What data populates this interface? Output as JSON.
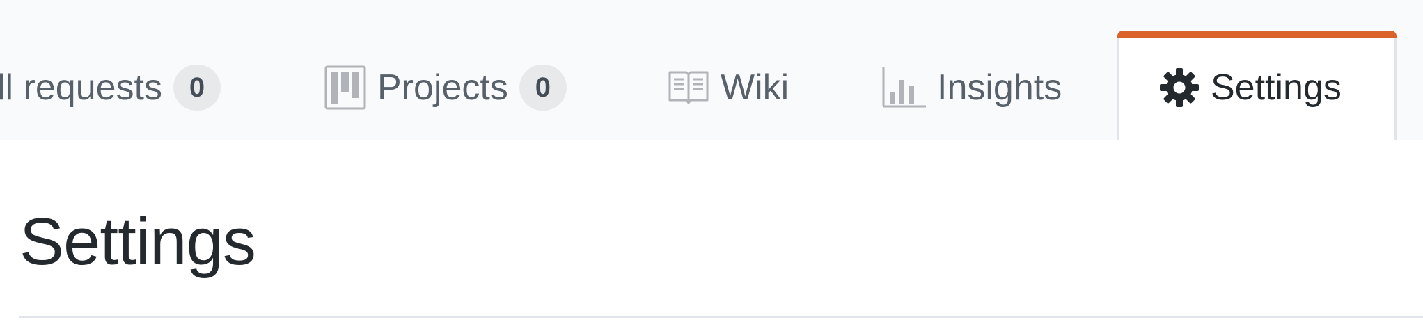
{
  "nav": {
    "tabs": [
      {
        "label": "ll requests",
        "count": "0",
        "icon": "pull-request-icon"
      },
      {
        "label": "Projects",
        "count": "0",
        "icon": "project-board-icon"
      },
      {
        "label": "Wiki",
        "icon": "book-icon"
      },
      {
        "label": "Insights",
        "icon": "graph-icon"
      },
      {
        "label": "Settings",
        "icon": "gear-icon",
        "selected": true
      }
    ]
  },
  "main": {
    "title": "Settings"
  },
  "colors": {
    "accent": "#d9632a",
    "nav_background": "#f9fafb",
    "text_muted": "#586069",
    "text_primary": "#24292e",
    "counter_background": "#e7e9eb"
  }
}
